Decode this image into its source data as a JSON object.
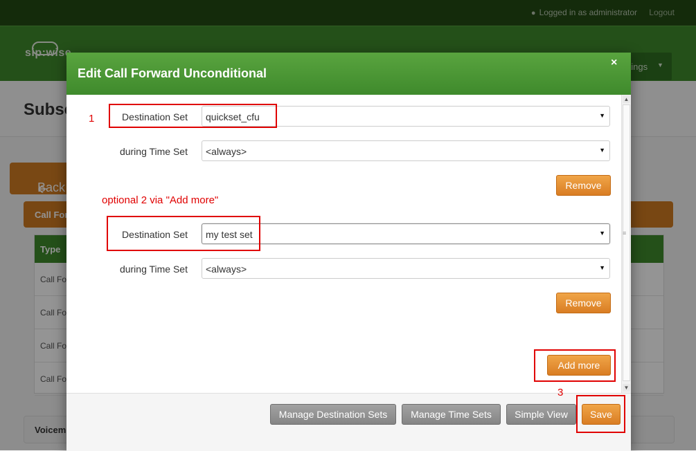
{
  "topbar": {
    "logged_in": "Logged in as administrator",
    "logout": "Logout"
  },
  "header": {
    "logo": "sip:wise",
    "settings_label": "ttings"
  },
  "page": {
    "title": "Subsc",
    "back_label": "Back",
    "accordion_label": "Call For",
    "voicemail_label": "Voicem"
  },
  "bg_table": {
    "header": "Type",
    "rows": [
      "Call Fo",
      "Call Fo",
      "Call Fo",
      "Call Fo"
    ]
  },
  "modal": {
    "title": "Edit Call Forward Unconditional",
    "close": "×",
    "group1": {
      "dest_label": "Destination Set",
      "dest_value": "quickset_cfu",
      "time_label": "during Time Set",
      "time_value": "<always>",
      "remove": "Remove"
    },
    "group2": {
      "dest_label": "Destination Set",
      "dest_value": "my test set",
      "time_label": "during Time Set",
      "time_value": "<always>",
      "remove": "Remove"
    },
    "add_more": "Add more",
    "footer": {
      "manage_dest": "Manage Destination Sets",
      "manage_time": "Manage Time Sets",
      "simple_view": "Simple View",
      "save": "Save"
    }
  },
  "annotations": {
    "a1": "1",
    "a2": "optional 2 via \"Add more\"",
    "a3": "3"
  },
  "colors": {
    "header_green": "#3f8a2c",
    "button_orange": "#d97d23",
    "annotation_red": "#e00000"
  }
}
